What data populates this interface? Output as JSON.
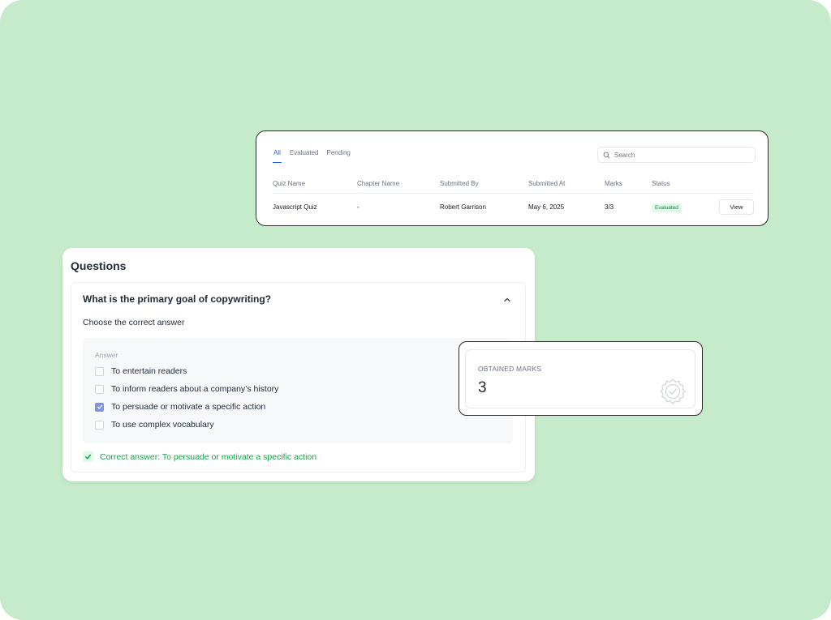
{
  "colors": {
    "background": "#c6ebca",
    "accent": "#2563eb",
    "success": "#16a34a",
    "checkbox_checked": "#7c93e6"
  },
  "table": {
    "tabs": [
      {
        "label": "All",
        "active": true
      },
      {
        "label": "Evaluated",
        "active": false
      },
      {
        "label": "Pending",
        "active": false
      }
    ],
    "search": {
      "placeholder": "Search",
      "icon": "search-icon"
    },
    "columns": [
      "Quiz Name",
      "Chapter Name",
      "Submitted By",
      "Submitted At",
      "Marks",
      "Status"
    ],
    "rows": [
      {
        "quiz_name": "Javascript Quiz",
        "chapter_name": "-",
        "submitted_by": "Robert Garrison",
        "submitted_at": "May 6, 2025",
        "marks": "3/3",
        "status": "Evaluated",
        "action": "View"
      }
    ]
  },
  "questions": {
    "title": "Questions",
    "question_text": "What is the primary goal of copywriting?",
    "instruction": "Choose the correct answer",
    "answer_label": "Answer",
    "options": [
      {
        "label": "To entertain readers",
        "checked": false
      },
      {
        "label": "To inform readers about a company’s history",
        "checked": false
      },
      {
        "label": "To persuade or motivate a specific action",
        "checked": true
      },
      {
        "label": "To use complex vocabulary",
        "checked": false
      }
    ],
    "correct_answer": "Correct answer: To persuade or motivate a specific action",
    "collapse_icon": "chevron-up-icon"
  },
  "marks": {
    "label": "OBTAINED MARKS",
    "value": "3",
    "icon": "verified-seal-icon"
  }
}
